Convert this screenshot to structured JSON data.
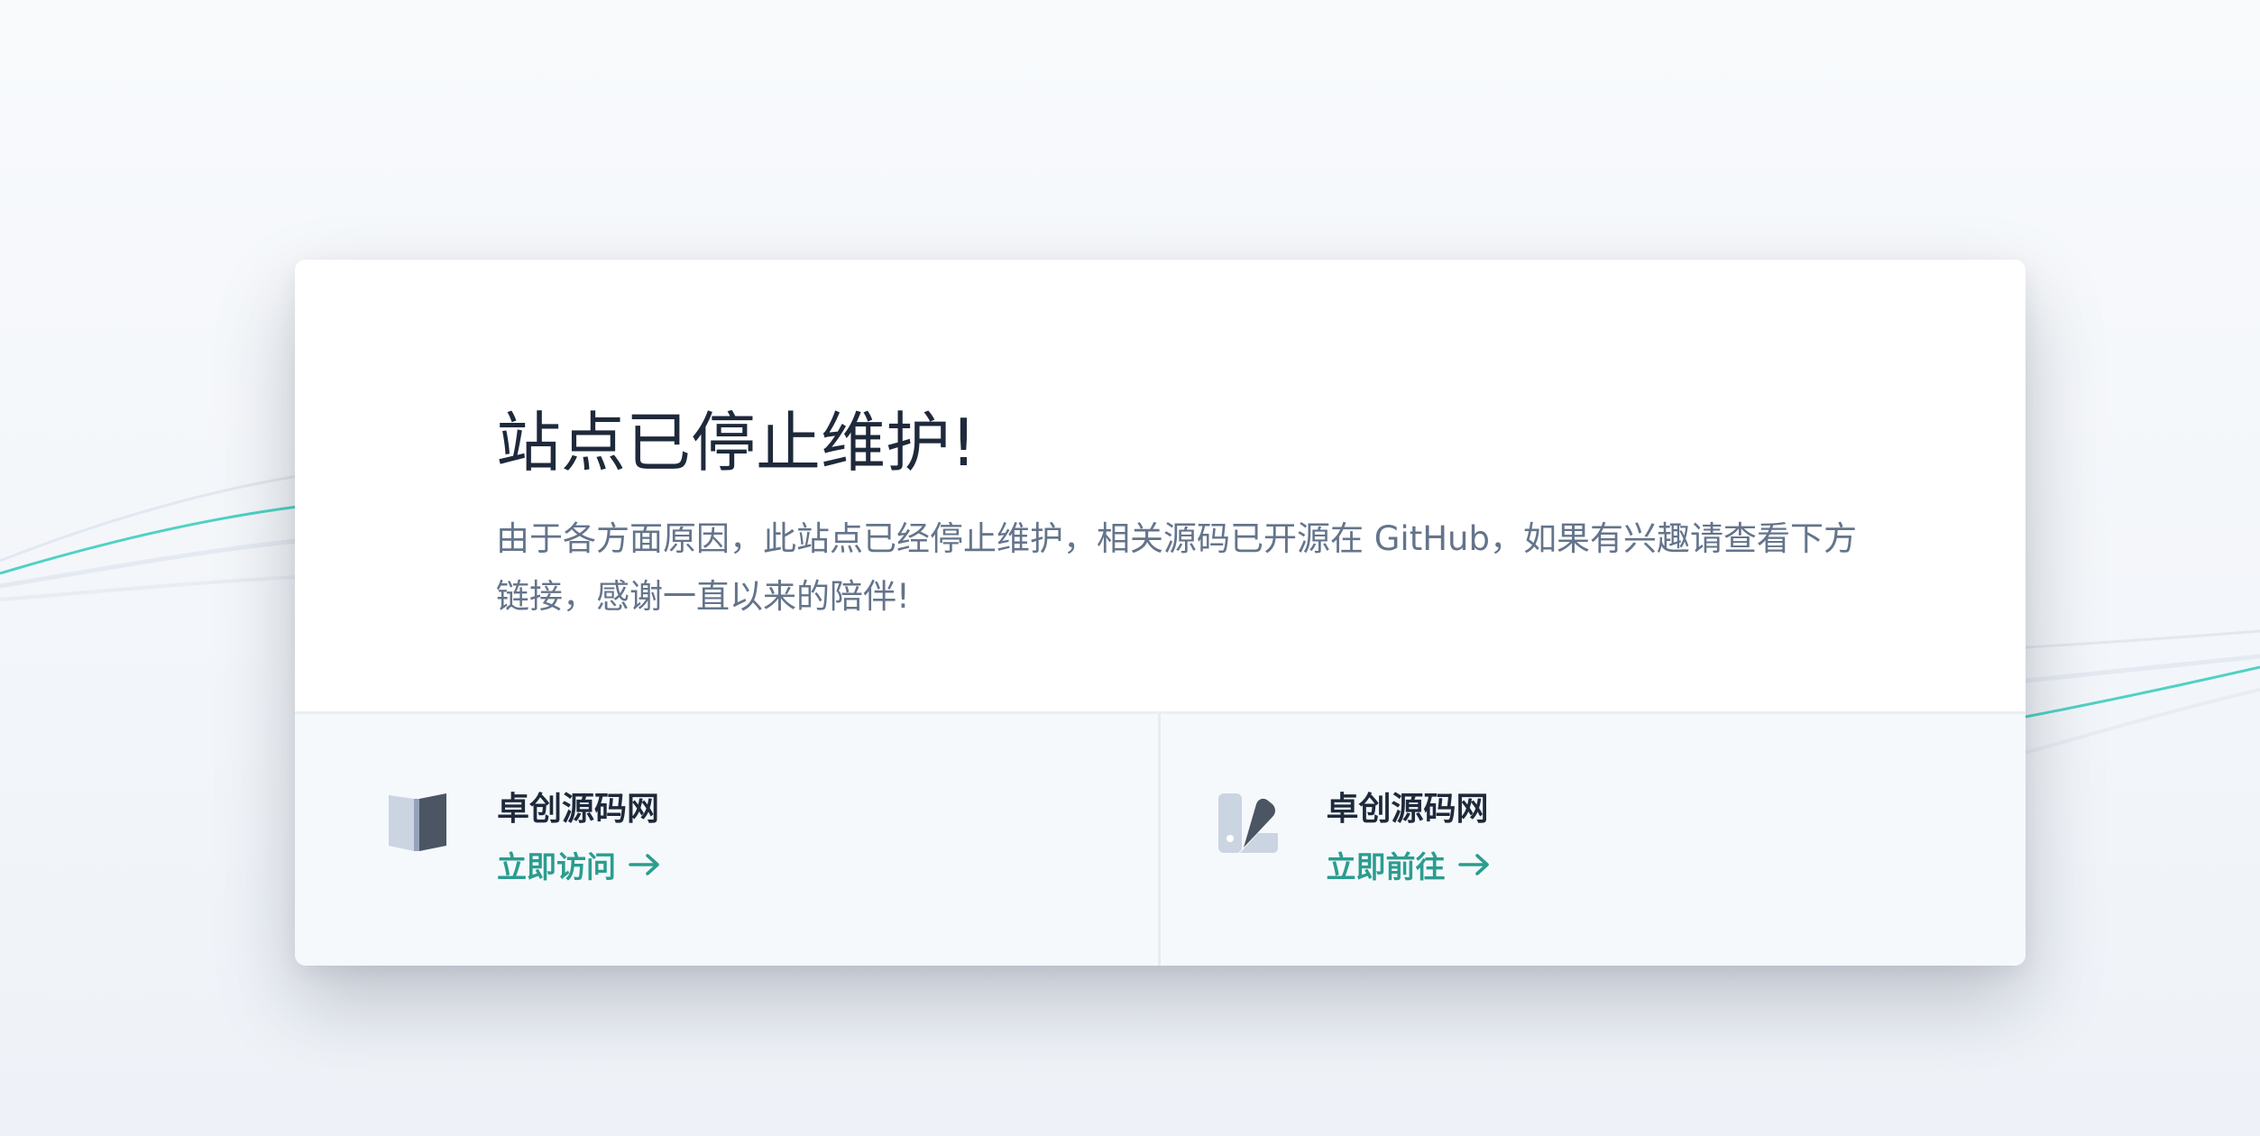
{
  "page": {
    "title": "站点已停止维护!",
    "description": "由于各方面原因，此站点已经停止维护，相关源码已开源在 GitHub，如果有兴趣请查看下方链接，感谢一直以来的陪伴!"
  },
  "links": [
    {
      "name": "卓创源码网",
      "action": "立即访问",
      "icon": "book-icon"
    },
    {
      "name": "卓创源码网",
      "action": "立即前往",
      "icon": "swatch-icon"
    }
  ],
  "colors": {
    "accent": "#2a9d8f",
    "title": "#1e293b",
    "body_text": "#64748b",
    "icon_dark": "#4b5563",
    "icon_light": "#cbd5e1",
    "line_accent": "#4fd1c5"
  }
}
